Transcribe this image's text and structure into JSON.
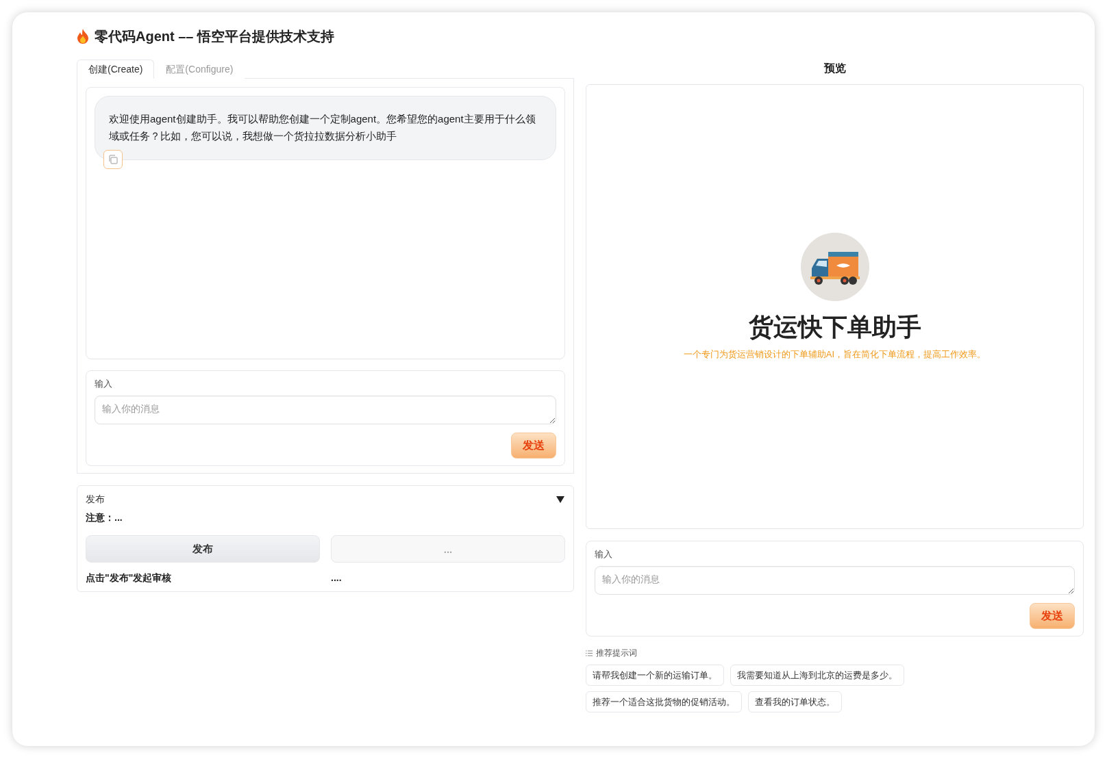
{
  "header": {
    "title": "零代码Agent –– 悟空平台提供技术支持"
  },
  "tabs": [
    {
      "label": "创建(Create)",
      "selected": true
    },
    {
      "label": "配置(Configure)",
      "selected": false
    }
  ],
  "chat": {
    "messages": [
      {
        "kind": "bot",
        "text": "欢迎使用agent创建助手。我可以帮助您创建一个定制agent。您希望您的agent主要用于什么领域或任务？比如，您可以说，我想做一个货拉拉数据分析小助手"
      }
    ]
  },
  "create_input": {
    "label": "输入",
    "placeholder": "输入你的消息",
    "send": "发送"
  },
  "publish": {
    "title": "发布",
    "expanded": true,
    "notice": "注意：...",
    "buttons": [
      {
        "label": "发布",
        "disabled": false
      },
      {
        "label": "...",
        "disabled": true
      }
    ],
    "notes": [
      "点击\"发布\"发起审核",
      "...."
    ]
  },
  "preview": {
    "title": "预览",
    "bot_name": "货运快下单助手",
    "description": "一个专门为货运营销设计的下单辅助AI，旨在简化下单流程，提高工作效率。"
  },
  "preview_input": {
    "label": "输入",
    "placeholder": "输入你的消息",
    "send": "发送"
  },
  "suggestions": {
    "label": "推荐提示词",
    "items": [
      "请帮我创建一个新的运输订单。",
      "我需要知道从上海到北京的运费是多少。",
      "推荐一个适合这批货物的促销活动。",
      "查看我的订单状态。"
    ]
  }
}
